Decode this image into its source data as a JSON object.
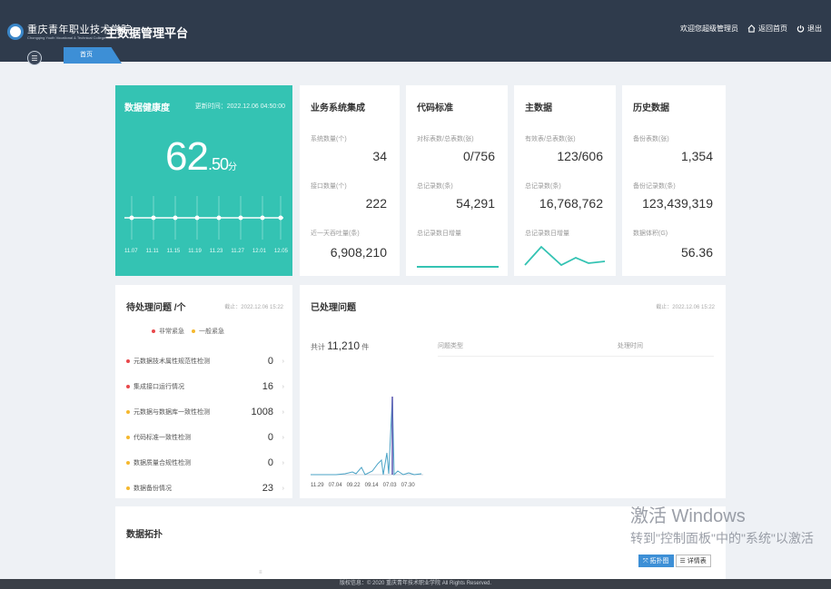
{
  "header": {
    "logo_text": "重庆青年职业技术学院",
    "logo_subtext": "Chongqing Youth Vocational & Technical College",
    "app_title": "主数据管理平台",
    "welcome": "欢迎您超级管理员",
    "home_label": "返回首页",
    "logout_label": "退出",
    "home_icon": "home-icon",
    "logout_icon": "power-icon",
    "menu_icon": "menu-icon"
  },
  "tabs": [
    {
      "label": "首页",
      "active": true
    }
  ],
  "health": {
    "title": "数据健康度",
    "update_time": "更新时间：2022.12.06 04:50:00",
    "score_int": "62",
    "score_dec": ".50",
    "score_unit": "分",
    "dates": [
      "11.07",
      "11.11",
      "11.15",
      "11.19",
      "11.23",
      "11.27",
      "12.01",
      "12.05"
    ],
    "color": "#34c3b3"
  },
  "cards": {
    "business": {
      "title": "业务系统集成",
      "m1_label": "系统数量(个)",
      "m1_value": "34",
      "m2_label": "接口数量(个)",
      "m2_value": "222",
      "m3_label": "近一天吞吐量(条)",
      "m3_value": "6,908,210"
    },
    "code": {
      "title": "代码标准",
      "m1_label": "对标表数/总表数(张)",
      "m1_value": "0/756",
      "m2_label": "总记录数(条)",
      "m2_value": "54,291",
      "m3_label": "总记录数日增量"
    },
    "master": {
      "title": "主数据",
      "m1_label": "有效表/总表数(张)",
      "m1_value": "123/606",
      "m2_label": "总记录数(条)",
      "m2_value": "16,768,762",
      "m3_label": "总记录数日增量"
    },
    "history": {
      "title": "历史数据",
      "m1_label": "备份表数(张)",
      "m1_value": "1,354",
      "m2_label": "备份记录数(条)",
      "m2_value": "123,439,319",
      "m3_label": "数据体积(G)",
      "m3_value": "56.36"
    }
  },
  "issues": {
    "title": "待处理问题 /个",
    "time": "截止：2022.12.06 15:22",
    "legend_urgent": "非常紧急",
    "legend_normal": "一般紧急",
    "urgent_color": "#e8484b",
    "normal_color": "#f5b82e",
    "items": [
      {
        "label": "元数据技术属性规范性检测",
        "count": "0",
        "level": "urgent"
      },
      {
        "label": "集成接口运行情况",
        "count": "16",
        "level": "urgent"
      },
      {
        "label": "元数据与数据库一致性检测",
        "count": "1008",
        "level": "normal"
      },
      {
        "label": "代码标准一致性检测",
        "count": "0",
        "level": "normal"
      },
      {
        "label": "数据质量合规性检测",
        "count": "0",
        "level": "normal"
      },
      {
        "label": "数据备份情况",
        "count": "23",
        "level": "normal"
      }
    ]
  },
  "processed": {
    "title": "已处理问题",
    "time": "截止：2022.12.06 15:22",
    "total_prefix": "共计",
    "total_value": "11,210",
    "total_unit": "件",
    "col_type": "问题类型",
    "col_time": "处理时间",
    "dates": [
      "11.29",
      "07.04",
      "09.22",
      "09.14",
      "07.03",
      "07.30"
    ]
  },
  "topology": {
    "title": "数据拓扑"
  },
  "watermark": {
    "line1": "激活 Windows",
    "line2": "转到\"控制面板\"中的\"系统\"以激活"
  },
  "float_buttons": {
    "full": "拓扑图",
    "detail": "详情表"
  },
  "footer": {
    "text": "版权信息：© 2020 重庆青年技术职业学院 All Rights Reserved."
  }
}
